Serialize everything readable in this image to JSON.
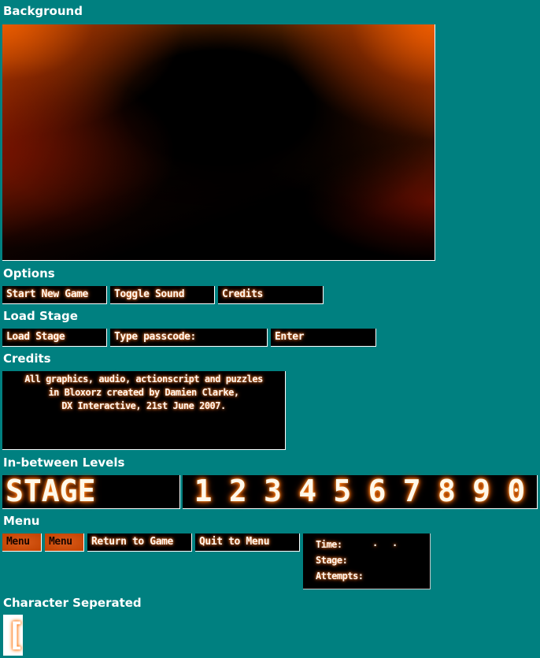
{
  "sections": {
    "background": "Background",
    "options": "Options",
    "load_stage": "Load Stage",
    "credits": "Credits",
    "in_between": "In-between Levels",
    "menu": "Menu",
    "char_sep": "Character Seperated"
  },
  "options_buttons": [
    "Start New Game",
    "Toggle Sound",
    "Credits"
  ],
  "load_stage": {
    "button": "Load Stage",
    "passcode_label": "Type passcode:",
    "enter": "Enter"
  },
  "credits_text": [
    "All graphics, audio, actionscript and puzzles",
    "in Bloxorz created by Damien Clarke,",
    "DX Interactive, 21st June 2007."
  ],
  "in_between": {
    "stage_word": "STAGE",
    "digits": [
      "1",
      "2",
      "3",
      "4",
      "5",
      "6",
      "7",
      "8",
      "9",
      "0"
    ]
  },
  "menu": {
    "menu_button_normal": "Menu",
    "menu_button_hover": "Menu",
    "return_to_game": "Return to Game",
    "quit_to_menu": "Quit to Menu"
  },
  "hud": {
    "time_label": "Time:",
    "time_separator": ".",
    "stage_label": "Stage:",
    "attempts_label": "Attempts:"
  },
  "char_separated": {
    "glyph": "["
  },
  "colors": {
    "page_bg": "#008080",
    "button_bg": "#000000",
    "accent_orange": "#c24200",
    "glow": "#ff8a3a"
  }
}
